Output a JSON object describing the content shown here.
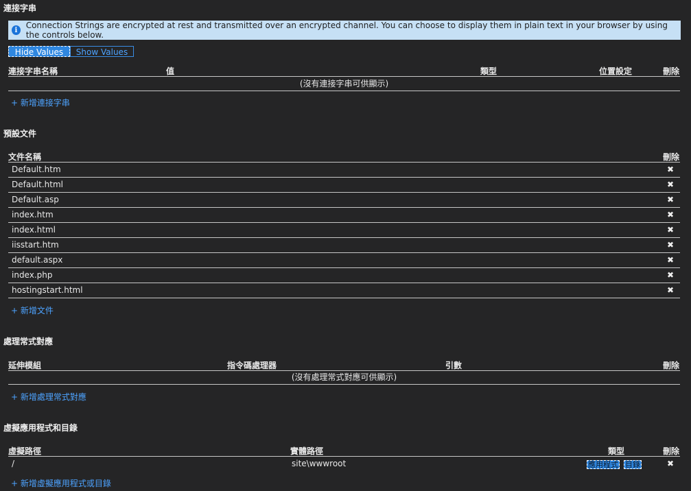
{
  "connection_strings": {
    "title": "連接字串",
    "info": "Connection Strings are encrypted at rest and transmitted over an encrypted channel. You can choose to display them in plain text in your browser by using the controls below.",
    "hide_label": "Hide Values",
    "show_label": "Show Values",
    "columns": [
      "連接字串名稱",
      "值",
      "類型",
      "位置設定",
      "刪除"
    ],
    "empty": "(沒有連接字串可供顯示)",
    "add": "+ 新增連接字串"
  },
  "default_documents": {
    "title": "預設文件",
    "columns": [
      "文件名稱",
      "刪除"
    ],
    "rows": [
      "Default.htm",
      "Default.html",
      "Default.asp",
      "index.htm",
      "index.html",
      "iisstart.htm",
      "default.aspx",
      "index.php",
      "hostingstart.html"
    ],
    "add": "+ 新增文件",
    "delete_glyph": "✖"
  },
  "handler_mappings": {
    "title": "處理常式對應",
    "columns": [
      "延伸模組",
      "指令碼處理器",
      "引數",
      "刪除"
    ],
    "empty": "(沒有處理常式對應可供顯示)",
    "add": "+ 新增處理常式對應"
  },
  "virtual_apps": {
    "title": "虛擬應用程式和目錄",
    "columns": [
      "虛擬路徑",
      "實體路徑",
      "類型",
      "刪除"
    ],
    "rows": [
      {
        "virtual_path": "/",
        "physical_path": "site\\wwwroot",
        "type_app": "應用程式",
        "type_dir": "目錄"
      }
    ],
    "add": "+ 新增虛擬應用程式或目錄",
    "delete_glyph": "✖"
  },
  "colors": {
    "background": "#252526",
    "accent": "#2f87e0",
    "link": "#4da3ff",
    "info_bg": "#c6e0f5"
  }
}
